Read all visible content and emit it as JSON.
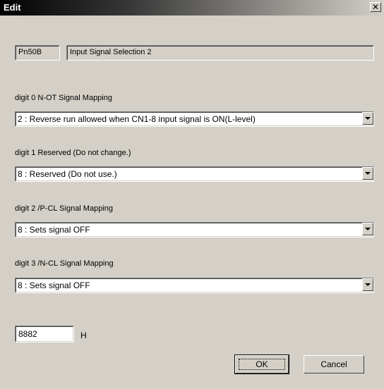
{
  "window": {
    "title": "Edit",
    "close_glyph": "✕"
  },
  "param": {
    "number": "Pn50B",
    "name": "Input Signal Selection 2"
  },
  "digits": [
    {
      "label": "digit 0  N-OT Signal Mapping",
      "selected": "2 : Reverse run allowed when CN1-8 input signal is ON(L-level)"
    },
    {
      "label": "digit 1  Reserved (Do not change.)",
      "selected": "8 : Reserved (Do not use.)"
    },
    {
      "label": "digit 2  /P-CL Signal Mapping",
      "selected": "8 : Sets signal OFF"
    },
    {
      "label": "digit 3  /N-CL Signal Mapping",
      "selected": "8 : Sets signal OFF"
    }
  ],
  "value": {
    "hex": "8882",
    "suffix": "H"
  },
  "buttons": {
    "ok": "OK",
    "cancel": "Cancel"
  }
}
